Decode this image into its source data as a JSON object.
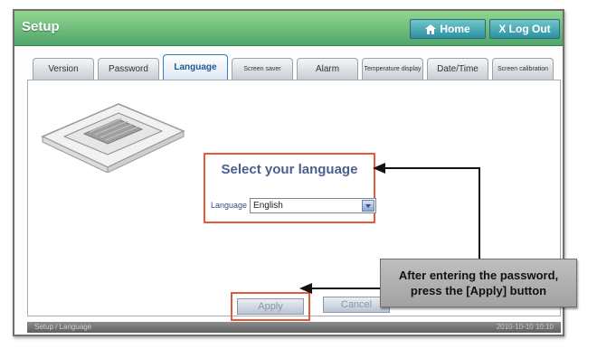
{
  "window": {
    "title": "Setup"
  },
  "header": {
    "home_label": "Home",
    "logout_label": "X Log Out"
  },
  "tabs": [
    {
      "label": "Version"
    },
    {
      "label": "Password"
    },
    {
      "label": "Language"
    },
    {
      "label": "Screen saver"
    },
    {
      "label": "Alarm"
    },
    {
      "label": "Temperature display"
    },
    {
      "label": "Date/Time"
    },
    {
      "label": "Screen calibration"
    }
  ],
  "language_section": {
    "heading": "Select your language",
    "field_label": "Language",
    "selected_value": "English"
  },
  "actions": {
    "apply_label": "Apply",
    "cancel_label": "Cancel"
  },
  "callout": {
    "line1": "After entering the password,",
    "line2": "press the [Apply] button"
  },
  "status_bar": {
    "left_text": "Setup / Language",
    "right_text": "2010-10-10 10:10"
  },
  "icons": {
    "home": "home-icon",
    "unit": "indoor-unit-image"
  },
  "colors": {
    "title_bar": "#4fa56a",
    "highlight": "#e35a3b",
    "active_tab": "#2f7cc1"
  }
}
